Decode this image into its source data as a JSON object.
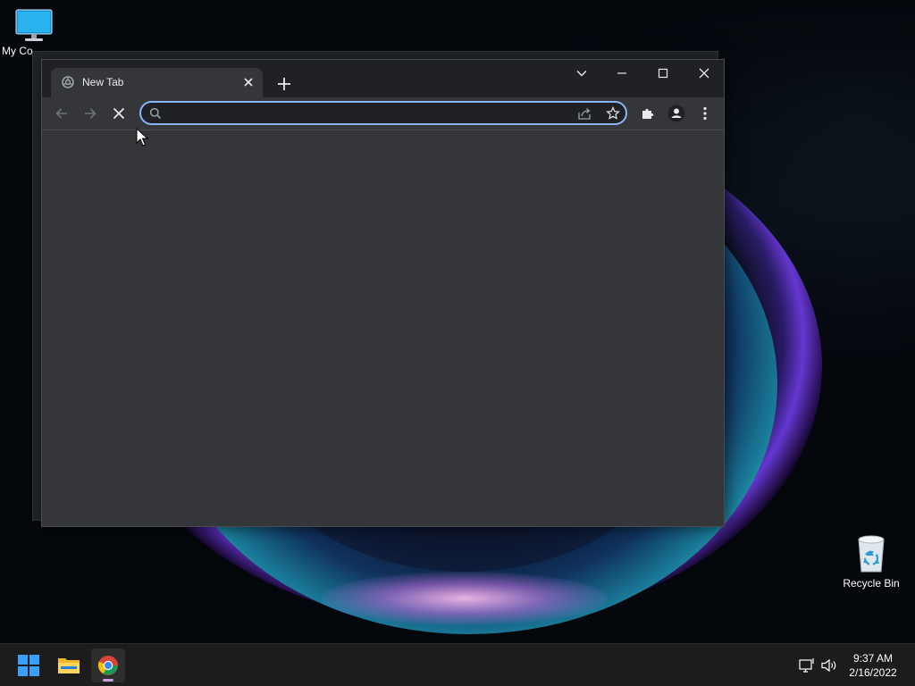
{
  "desktop": {
    "icons": [
      {
        "label": "My Co",
        "icon": "monitor-icon"
      },
      {
        "label": "Recycle Bin",
        "icon": "recycle-bin-icon"
      }
    ]
  },
  "browser": {
    "tab": {
      "title": "New Tab",
      "icon": "chrome-loading-icon"
    },
    "omnibox": {
      "value": "",
      "placeholder": ""
    },
    "controls": [
      "tab-search-icon",
      "minimize-icon",
      "maximize-icon",
      "close-icon"
    ],
    "toolbar_icons": [
      "back-arrow-icon",
      "forward-arrow-icon",
      "stop-loading-icon",
      "search-icon",
      "share-icon",
      "star-icon",
      "puzzle-extensions-icon",
      "profile-icon",
      "three-dot-menu-icon"
    ],
    "accent_color": "#8ab4f8",
    "background_color": "#35363a"
  },
  "taskbar": {
    "apps": [
      {
        "name": "Start",
        "icon": "windows-logo-icon"
      },
      {
        "name": "File Explorer",
        "icon": "folder-icon"
      },
      {
        "name": "Google Chrome",
        "icon": "chrome-icon",
        "active": true
      }
    ],
    "tray_icons": [
      "network-icon",
      "volume-icon"
    ],
    "clock": {
      "time": "9:37 AM",
      "date": "2/16/2022"
    }
  }
}
